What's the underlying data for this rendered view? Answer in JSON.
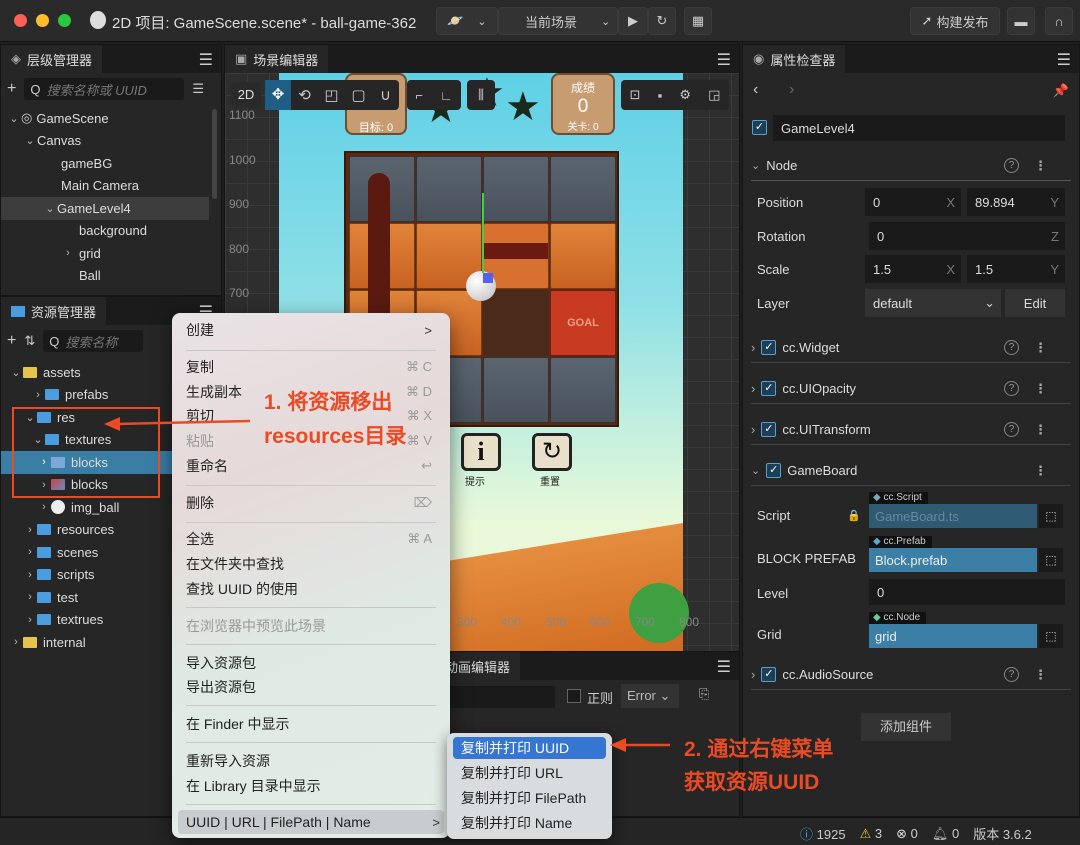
{
  "window": {
    "title": "2D 项目: GameScene.scene* - ball-game-362",
    "scene_select": "当前场景",
    "build_button": "构建发布"
  },
  "hierarchy": {
    "title": "层级管理器",
    "search_placeholder": "搜索名称或 UUID",
    "nodes": [
      {
        "label": "GameScene"
      },
      {
        "label": "Canvas"
      },
      {
        "label": "gameBG"
      },
      {
        "label": "Main Camera"
      },
      {
        "label": "GameLevel4"
      },
      {
        "label": "background"
      },
      {
        "label": "grid"
      },
      {
        "label": "Ball"
      }
    ]
  },
  "assets": {
    "title": "资源管理器",
    "search_placeholder": "搜索名称",
    "items": [
      {
        "label": "assets"
      },
      {
        "label": "prefabs"
      },
      {
        "label": "res"
      },
      {
        "label": "textures"
      },
      {
        "label": "blocks"
      },
      {
        "label": "blocks"
      },
      {
        "label": "img_ball"
      },
      {
        "label": "resources"
      },
      {
        "label": "scenes"
      },
      {
        "label": "scripts"
      },
      {
        "label": "test"
      },
      {
        "label": "textrues"
      },
      {
        "label": "internal"
      }
    ]
  },
  "scene": {
    "title": "场景编辑器",
    "mode_2d": "2D",
    "ruler_y": [
      "1100",
      "1000",
      "900",
      "800",
      "700"
    ],
    "ruler_x": [
      "300",
      "400",
      "500",
      "600",
      "700",
      "800"
    ],
    "game": {
      "score_label": "成绩",
      "score_value": "0",
      "level_label": "关卡: 0",
      "target_label": "目标: 0",
      "goal_text": "GOAL",
      "hint_label": "提示",
      "reset_label": "重置"
    }
  },
  "console": {
    "tab": "动画编辑器",
    "regex_label": "正则",
    "level_select": "Error"
  },
  "inspector": {
    "title": "属性检查器",
    "node_name": "GameLevel4",
    "node_section": "Node",
    "position": {
      "label": "Position",
      "x": "0",
      "y": "89.894"
    },
    "rotation": {
      "label": "Rotation",
      "z": "0"
    },
    "scale": {
      "label": "Scale",
      "x": "1.5",
      "y": "1.5"
    },
    "layer": {
      "label": "Layer",
      "value": "default",
      "edit": "Edit"
    },
    "components": [
      {
        "label": "cc.Widget"
      },
      {
        "label": "cc.UIOpacity"
      },
      {
        "label": "cc.UITransform"
      },
      {
        "label": "GameBoard"
      },
      {
        "label": "cc.AudioSource"
      }
    ],
    "props": {
      "script_label": "Script",
      "script_type": "cc.Script",
      "script_value": "GameBoard.ts",
      "prefab_label": "BLOCK PREFAB",
      "prefab_type": "cc.Prefab",
      "prefab_value": "Block.prefab",
      "level_label": "Level",
      "level_value": "0",
      "grid_label": "Grid",
      "grid_type": "cc.Node",
      "grid_value": "grid"
    },
    "add_component": "添加组件"
  },
  "context_menu": {
    "items": [
      {
        "label": "创建",
        "shortcut": ">"
      },
      {
        "label": "复制",
        "shortcut": "⌘ C"
      },
      {
        "label": "生成副本",
        "shortcut": "⌘ D"
      },
      {
        "label": "剪切",
        "shortcut": "⌘ X"
      },
      {
        "label": "粘贴",
        "shortcut": "⌘ V"
      },
      {
        "label": "重命名",
        "shortcut": "↩"
      },
      {
        "label": "删除",
        "shortcut": "⌦"
      },
      {
        "label": "全选",
        "shortcut": "⌘ A"
      },
      {
        "label": "在文件夹中查找"
      },
      {
        "label": "查找 UUID 的使用"
      },
      {
        "label": "在浏览器中预览此场景"
      },
      {
        "label": "导入资源包"
      },
      {
        "label": "导出资源包"
      },
      {
        "label": "在 Finder 中显示"
      },
      {
        "label": "重新导入资源"
      },
      {
        "label": "在 Library 目录中显示"
      },
      {
        "label": "UUID | URL | FilePath | Name",
        "shortcut": ">"
      }
    ]
  },
  "submenu": {
    "items": [
      {
        "label": "复制并打印 UUID"
      },
      {
        "label": "复制并打印 URL"
      },
      {
        "label": "复制并打印 FilePath"
      },
      {
        "label": "复制并打印 Name"
      }
    ]
  },
  "annotations": {
    "step1_line1": "1. 将资源移出",
    "step1_line2": "resources目录",
    "step2_line1": "2. 通过右键菜单",
    "step2_line2": "获取资源UUID",
    "color": "#ea4a24"
  },
  "status": {
    "info": "1925",
    "warn": "3",
    "error": "0",
    "notify": "0",
    "version": "版本 3.6.2"
  }
}
